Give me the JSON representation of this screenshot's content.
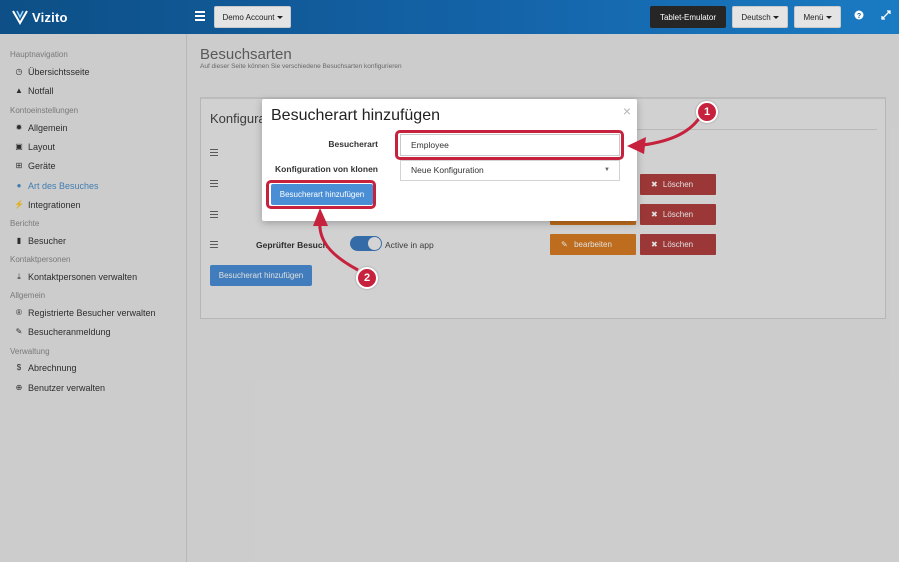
{
  "app": {
    "name": "Vizito"
  },
  "topbar": {
    "account_label": "Demo Account",
    "tablet_label": "Tablet-Emulator",
    "language_label": "Deutsch",
    "menu_label": "Menü"
  },
  "sidebar": {
    "sections": [
      {
        "title": "Hauptnavigation"
      },
      {
        "title": "Kontoeinstellungen"
      },
      {
        "title": "Berichte"
      },
      {
        "title": "Kontaktpersonen"
      },
      {
        "title": "Allgemein"
      },
      {
        "title": "Verwaltung"
      }
    ],
    "items": [
      {
        "label": "Übersichtsseite",
        "icon": "dashboard-icon"
      },
      {
        "label": "Notfall",
        "icon": "warning-icon"
      },
      {
        "label": "Allgemein",
        "icon": "gear-icon"
      },
      {
        "label": "Layout",
        "icon": "image-icon"
      },
      {
        "label": "Geräte",
        "icon": "sitemap-icon"
      },
      {
        "label": "Art des Besuches",
        "icon": "users-icon",
        "active": true
      },
      {
        "label": "Integrationen",
        "icon": "plug-icon"
      },
      {
        "label": "Besucher",
        "icon": "book-icon"
      },
      {
        "label": "Kontaktpersonen verwalten",
        "icon": "download-icon"
      },
      {
        "label": "Registrierte Besucher verwalten",
        "icon": "registered-icon"
      },
      {
        "label": "Besucheranmeldung",
        "icon": "pencil-icon"
      },
      {
        "label": "Abrechnung",
        "icon": "dollar-icon"
      },
      {
        "label": "Benutzer verwalten",
        "icon": "user-plus-icon"
      }
    ]
  },
  "page": {
    "title": "Besuchsarten",
    "subtitle": "Auf dieser Seite können Sie verschiedene Besuchsarten konfigurieren"
  },
  "panel": {
    "title": "Konfigura",
    "rows": [
      {
        "name": "",
        "toggle_label": "",
        "edit_label": "",
        "delete_label": "Löschen"
      },
      {
        "name": "",
        "toggle_label": "",
        "edit_label": "",
        "delete_label": "Löschen"
      },
      {
        "name": "Geprüfter Besuch",
        "toggle_label": "Active in app",
        "edit_label": "bearbeiten",
        "delete_label": "Löschen"
      }
    ],
    "add_button_label": "Besucherart hinzufügen"
  },
  "modal": {
    "title": "Besucherart hinzufügen",
    "close_glyph": "×",
    "visitor_type_label": "Besucherart",
    "visitor_type_value": "Employee",
    "clone_label": "Konfiguration von klonen",
    "clone_value": "Neue Konfiguration",
    "submit_label": "Besucherart hinzufügen"
  },
  "annotations": [
    {
      "number": "1"
    },
    {
      "number": "2"
    }
  ],
  "colors": {
    "topbar": "#1463a8",
    "accent": "#4a8fd6",
    "edit": "#d97c22",
    "delete": "#b23f3f",
    "highlight": "#c6213d"
  }
}
